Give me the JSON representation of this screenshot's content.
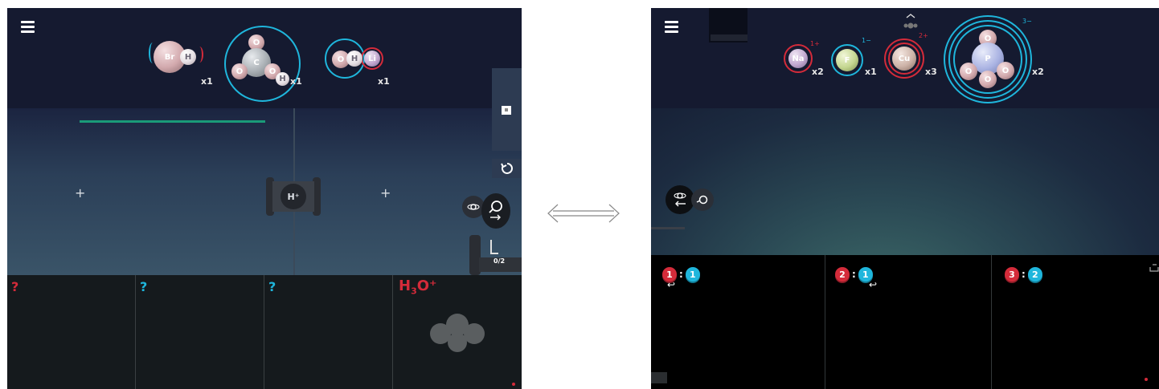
{
  "left_screen": {
    "molecules": [
      {
        "atoms": [
          "Br",
          "H"
        ],
        "count": "x1"
      },
      {
        "atoms": [
          "O",
          "C",
          "O",
          "O",
          "H"
        ],
        "count": "x1"
      },
      {
        "atoms": [
          "O",
          "H",
          "Li"
        ],
        "count": "x1"
      }
    ],
    "lab": {
      "center_device_label": "H⁺",
      "capture_counter": "0/2"
    },
    "tray_slots": [
      {
        "label": "?",
        "color": "#d42b3a"
      },
      {
        "label": "?",
        "color": "#1fb6dc"
      },
      {
        "label": "?",
        "color": "#1fb6dc"
      },
      {
        "label_main": "H",
        "label_sub": "3",
        "label_tail": "O⁺",
        "color": "#d42b3a"
      }
    ],
    "icons": [
      "menu-icon",
      "reset-icon",
      "magnify-icon",
      "atom-icon",
      "arrow-right-icon"
    ]
  },
  "right_screen": {
    "ions": [
      {
        "symbol": "Na",
        "charge": "1+",
        "count": "x2",
        "ring": "#d42b3a"
      },
      {
        "symbol": "F",
        "charge": "1−",
        "count": "x1",
        "ring": "#1fb6dc"
      },
      {
        "symbol": "Cu",
        "charge": "2+",
        "count": "x3",
        "ring": "#d42b3a"
      },
      {
        "symbol": "P",
        "charge": "3−",
        "count": "x2",
        "ring": "#1fb6dc",
        "atoms": [
          "O",
          "P",
          "O",
          "O",
          "O"
        ]
      }
    ],
    "ratios": [
      {
        "left": "1",
        "right": "1"
      },
      {
        "left": "2",
        "right": "1"
      },
      {
        "left": "3",
        "right": "2"
      }
    ],
    "icons": [
      "menu-icon",
      "chevron-up-icon",
      "atom-icon",
      "magnify-icon",
      "arrow-left-icon",
      "exit-icon"
    ]
  },
  "colors": {
    "accent_blue": "#1fb6dc",
    "accent_red": "#d42b3a",
    "progress_green": "#1a9a78"
  }
}
